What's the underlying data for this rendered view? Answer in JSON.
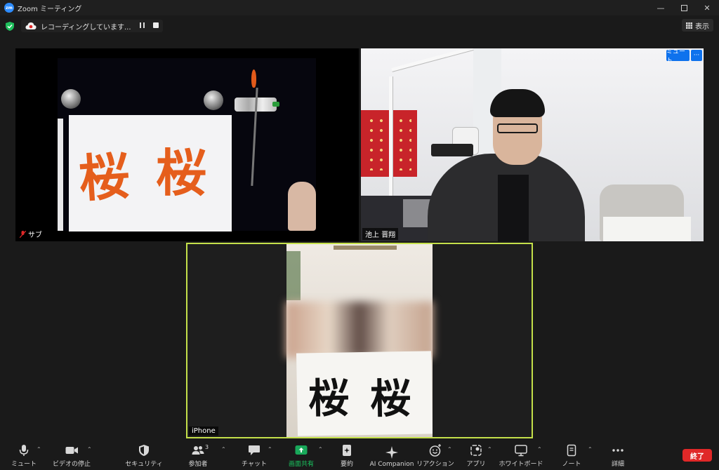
{
  "window": {
    "title": "Zoom ミーティング",
    "logo_text": "zm"
  },
  "recording": {
    "status_text": "レコーディングしています...",
    "pause_icon": "pause-icon",
    "stop_icon": "stop-icon"
  },
  "view_button": {
    "label": "表示",
    "icon": "grid-icon"
  },
  "participants": [
    {
      "name": "サブ",
      "muted": true
    },
    {
      "name": "池上 晋翔",
      "mute_label": "ミュート",
      "more_label": "···"
    },
    {
      "name": "iPhone"
    }
  ],
  "calligraphy": {
    "left_text": "桜",
    "right_text": "桜"
  },
  "toolbar": {
    "mute": "ミュート",
    "video": "ビデオの停止",
    "security": "セキュリティ",
    "participants": "参加者",
    "participants_count": "3",
    "chat": "チャット",
    "share": "画面共有",
    "summary": "要約",
    "ai": "AI Companion",
    "reactions": "リアクション",
    "apps": "アプリ",
    "whiteboard": "ホワイトボード",
    "notes": "ノート",
    "more": "詳細",
    "end": "終了",
    "share_color": "#19a85a",
    "end_color": "#e02828"
  }
}
